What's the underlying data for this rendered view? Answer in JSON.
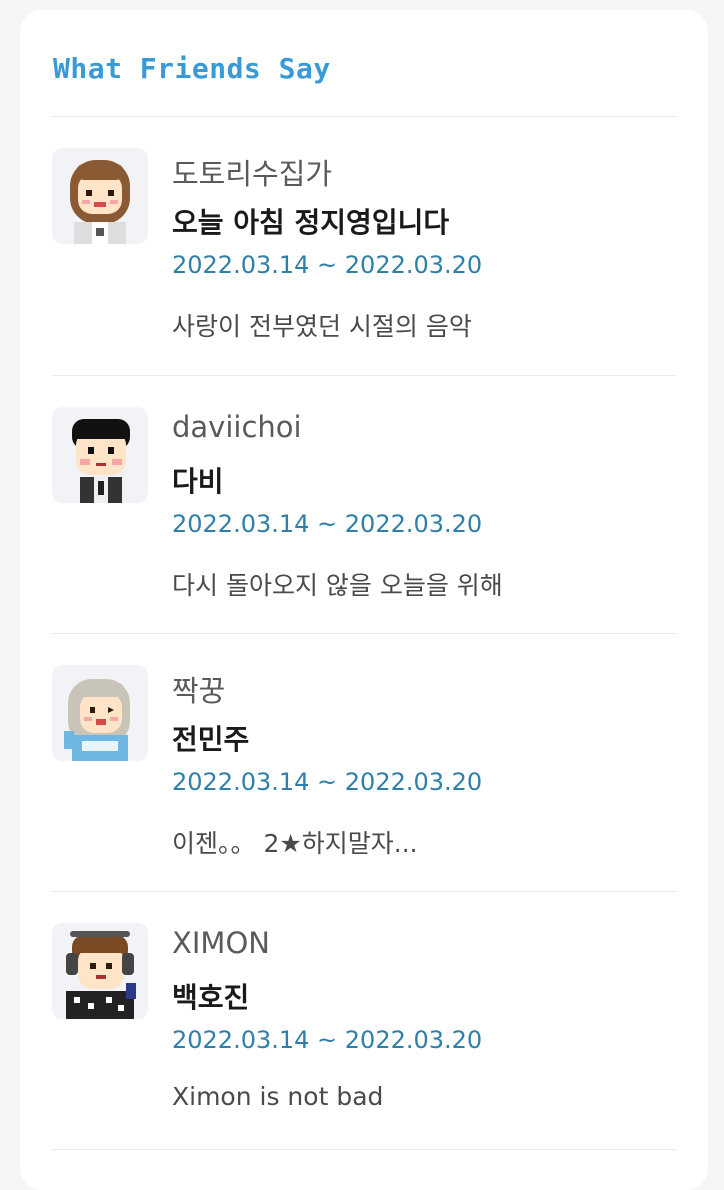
{
  "section": {
    "title": "What Friends Say"
  },
  "entries": [
    {
      "nickname": "도토리수집가",
      "name": "오늘 아침 정지영입니다",
      "dates": "2022.03.14 ~ 2022.03.20",
      "message": "사랑이 전부였던 시절의 음악",
      "avatar_icon": "avatar-girl-brown-hair-icon"
    },
    {
      "nickname": "daviichoi",
      "name": "다비",
      "dates": "2022.03.14 ~ 2022.03.20",
      "message": "다시 돌아오지 않을 오늘을 위해",
      "avatar_icon": "avatar-boy-black-hair-icon"
    },
    {
      "nickname": "짝꿍",
      "name": "전민주",
      "dates": "2022.03.14 ~ 2022.03.20",
      "message": "이젠。。 2★하지말자...",
      "avatar_icon": "avatar-girl-silver-hair-icon"
    },
    {
      "nickname": "XIMON",
      "name": "백호진",
      "dates": "2022.03.14 ~ 2022.03.20",
      "message": "Ximon is not bad",
      "avatar_icon": "avatar-boy-headphones-icon"
    }
  ],
  "colors": {
    "title": "#3a9ad6",
    "dates": "#2f7fa8",
    "background": "#f5f6f8",
    "card": "#ffffff"
  }
}
